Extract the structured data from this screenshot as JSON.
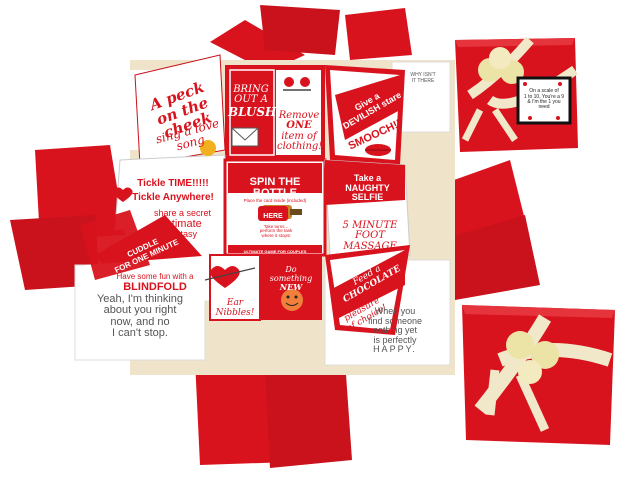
{
  "colors": {
    "red": "#d8131e",
    "dark_red": "#a80c14",
    "cream": "#efe3c9",
    "white": "#ffffff",
    "ribbon": "#f1e8c9",
    "rose": "#ece3a6",
    "gray_text": "#555555"
  },
  "cards": {
    "peck": {
      "line1": "A peck",
      "line2": "on the cheek",
      "line3": "sing a love",
      "line4": "song"
    },
    "blush": {
      "line1": "BRING",
      "line2": "OUT A",
      "line3": "BLUSH!!"
    },
    "remove": {
      "line1": "Remove",
      "line2": "ONE",
      "line3": "item of",
      "line4": "clothing!"
    },
    "stare": {
      "line1": "Give a",
      "line2": "DEVILISH stare",
      "line3": "SMOOCH!!"
    },
    "tickle": {
      "line1": "Tickle TIME!!!!!",
      "line2": "Tickle Anywhere!"
    },
    "secret": {
      "line1": "share a secret",
      "line2": "intimate",
      "line3": "fantasy"
    },
    "spin": {
      "title": "SPIN THE",
      "title2": "BOTTLE",
      "sub": "Place the card inside (included)",
      "here": "HERE",
      "rule1": "Take turns...",
      "rule2": "perform the task",
      "rule3": "where it stops!",
      "footer": "ULTIMATE GAME FOR COUPLES"
    },
    "selfie": {
      "line1": "Take a",
      "line2": "NAUGHTY",
      "line3": "SELFIE"
    },
    "massage": {
      "line1": "5 MINUTE",
      "line2": "FOOT MASSAGE"
    },
    "cuddle": {
      "line1": "CUDDLE",
      "line2": "FOR ONE MINUTE"
    },
    "fun": {
      "line1": "Have some fun with a",
      "line2": "BLINDFOLD"
    },
    "ear": {
      "line1": "Ear",
      "line2": "Nibbles!"
    },
    "new": {
      "line1": "Do",
      "line2": "something",
      "line3": "NEW"
    },
    "chocolate": {
      "line1": "Feed a",
      "line2": "CHOCOLATE",
      "line3": "pleasure",
      "line4": "of choice!"
    },
    "yeah": {
      "line1": "Yeah, I'm thinking",
      "line2": "about you right",
      "line3": "now, and no",
      "line4": "I can't stop."
    },
    "perfect": {
      "line1": "When you",
      "line2": "find someone",
      "line3": "nothing yet",
      "line4": "is perfectly",
      "line5": "HAPPY."
    },
    "scale": {
      "line1": "On a scale of",
      "line2": "1 to 10, You're a 9",
      "line3": "& I'm the 1 you",
      "line4": "need"
    },
    "corner_top": {
      "line1": "WHY ISN'T",
      "line2": "IT THERE"
    }
  }
}
